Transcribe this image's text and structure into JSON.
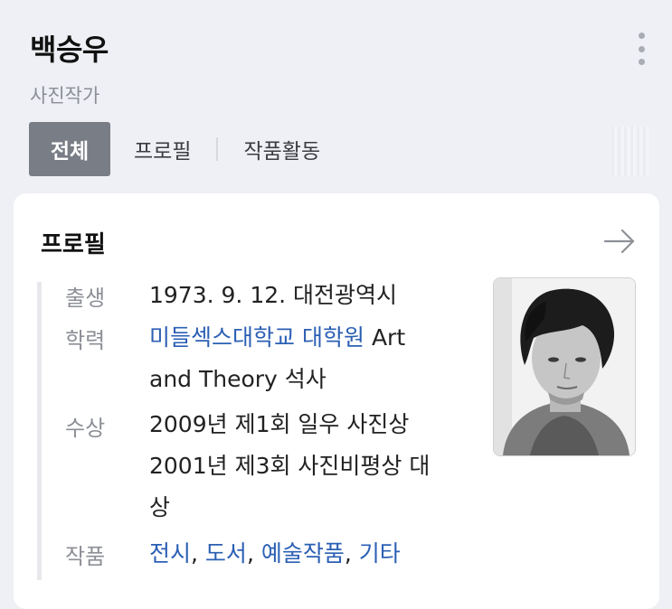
{
  "header": {
    "name": "백승우",
    "subtitle": "사진작가"
  },
  "tabs": [
    {
      "label": "전체",
      "active": true
    },
    {
      "label": "프로필",
      "active": false
    },
    {
      "label": "작품활동",
      "active": false
    }
  ],
  "profile": {
    "title": "프로필",
    "rows": {
      "birth": {
        "label": "출생",
        "value": "1973. 9. 12. 대전광역시"
      },
      "education": {
        "label": "학력",
        "link1": "미들섹스대학교",
        "link2": "대학원",
        "rest1": "Art",
        "rest2": "and Theory 석사"
      },
      "awards": {
        "label": "수상",
        "line1": "2009년 제1회 일우 사진상",
        "line2": "2001년 제3회 사진비평상 대",
        "line3": "상"
      },
      "works": {
        "label": "작품",
        "items": [
          "전시",
          "도서",
          "예술작품",
          "기타"
        ],
        "separator": ","
      }
    }
  },
  "icons": {
    "more": "more-vertical-icon",
    "arrow": "arrow-right-icon"
  },
  "colors": {
    "active_tab": "#797d85",
    "link": "#2b5fb4",
    "background": "#eef0f5"
  }
}
